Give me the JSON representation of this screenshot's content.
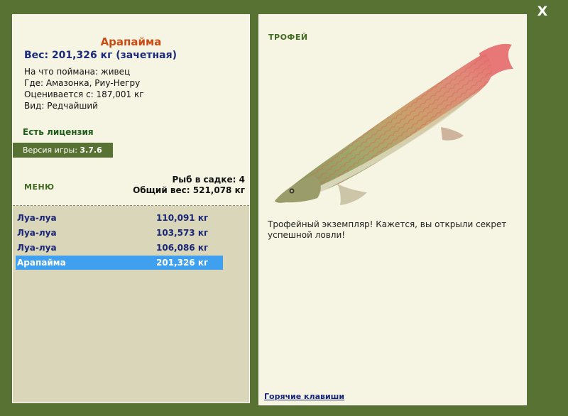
{
  "window": {
    "close_label": "X"
  },
  "fish": {
    "name": "Арапайма",
    "weight_line": "Вес: 201,326 кг (зачетная)"
  },
  "details": [
    {
      "label": "На что поймана:",
      "value": "живец"
    },
    {
      "label": "Где:",
      "value": "Амазонка, Риу-Негру"
    },
    {
      "label": "Оценивается с:",
      "value": "187,001 кг"
    },
    {
      "label": "Вид:",
      "value": "Редчайший"
    }
  ],
  "license": "Есть лицензия",
  "version": {
    "label": "Версия игры:",
    "value": "3.7.6"
  },
  "menu_label": "МЕНЮ",
  "stats": {
    "count": "Рыб в садке: 4",
    "total": "Общий вес: 521,078 кг"
  },
  "catch": [
    {
      "name": "Луа-луа",
      "weight": "110,091 кг"
    },
    {
      "name": "Луа-луа",
      "weight": "103,573 кг"
    },
    {
      "name": "Луа-луа",
      "weight": "106,086 кг"
    },
    {
      "name": "Арапайма",
      "weight": "201,326 кг"
    }
  ],
  "trophy": {
    "label": "ТРОФЕЙ",
    "text": "Трофейный экземпляр! Кажется, вы открыли секрет успешной ловли!"
  },
  "hotkeys_label": "Горячие клавиши",
  "colors": {
    "background": "#577232",
    "panel": "#f6f4e3",
    "list_bg": "#d9d6b9",
    "selected": "#3ea0ee",
    "fish_name": "#c94c14",
    "weight": "#1c2b7a"
  },
  "icons": {
    "close": "close-icon",
    "fish": "arapaima-fish-image"
  }
}
